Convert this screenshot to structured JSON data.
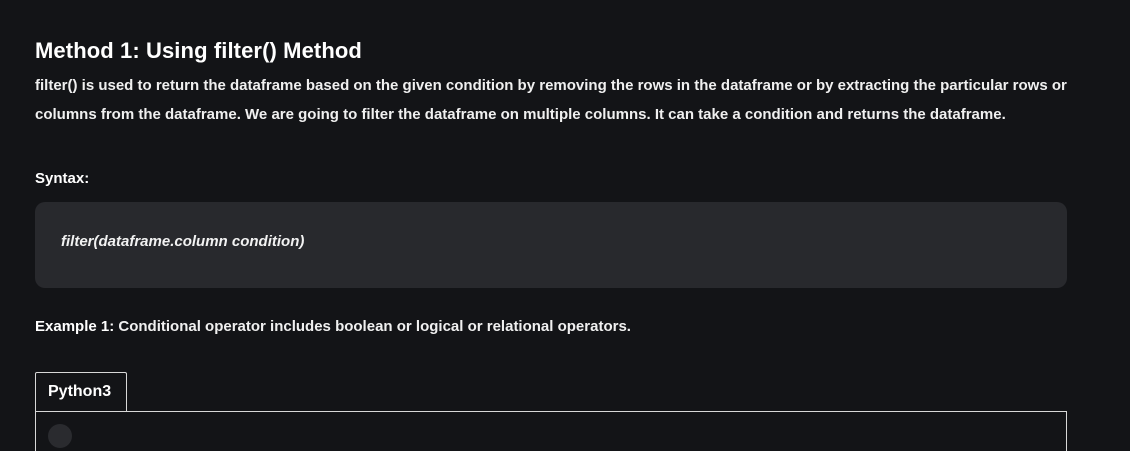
{
  "article": {
    "heading": "Method 1: Using filter() Method",
    "paragraph": "filter() is used to return the dataframe based on the given condition by removing the rows in the dataframe or by extracting the particular rows or columns from the dataframe. We are going to filter the dataframe on multiple columns. It can take a condition and returns the dataframe.",
    "syntax_label": "Syntax:",
    "syntax_code": "filter(dataframe.column condition)",
    "example_label": "Example 1:",
    "example_text": " Conditional operator includes boolean or logical or relational operators.",
    "code_tab_label": "Python3"
  }
}
